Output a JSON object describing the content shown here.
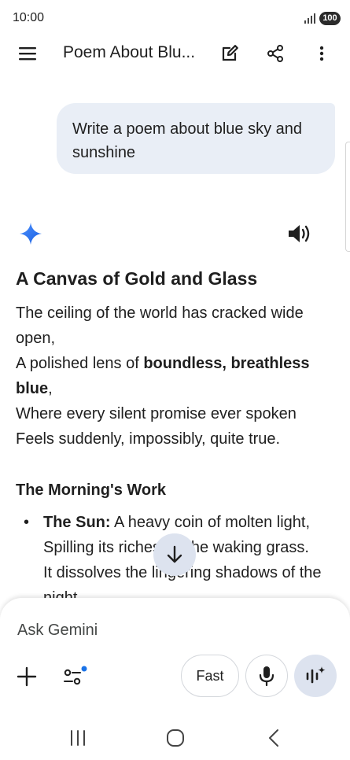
{
  "status_bar": {
    "time": "10:00",
    "battery": "100"
  },
  "header": {
    "title": "Poem About Blu..."
  },
  "user_message": {
    "text": "Write a poem about blue sky and sunshine"
  },
  "response": {
    "title": "A Canvas of Gold and Glass",
    "stanza1": {
      "line1": "The ceiling of the world has cracked wide open,",
      "line2_start": "A polished lens of ",
      "line2_bold": "boundless, breathless blue",
      "line2_end": ",",
      "line3": "Where every silent promise ever spoken",
      "line4": "Feels suddenly, impossibly, quite true."
    },
    "section_heading": "The Morning's Work",
    "bullet1": {
      "label": "The Sun:",
      "text": " A heavy coin of molten light,",
      "line2": "Spilling its riches on the waking grass.",
      "line3": "It dissolves the lingering shadows of the",
      "line4": "night"
    }
  },
  "input": {
    "placeholder": "Ask Gemini"
  },
  "buttons": {
    "fast": "Fast"
  },
  "colors": {
    "accent": "#1a73e8",
    "bubble": "#e9eef6",
    "chip": "#dde3ef"
  },
  "icons": [
    "menu-icon",
    "edit-icon",
    "share-icon",
    "more-vert-icon",
    "gemini-star-icon",
    "speaker-icon",
    "arrow-down-icon",
    "plus-icon",
    "tools-icon",
    "mic-icon",
    "live-icon"
  ]
}
